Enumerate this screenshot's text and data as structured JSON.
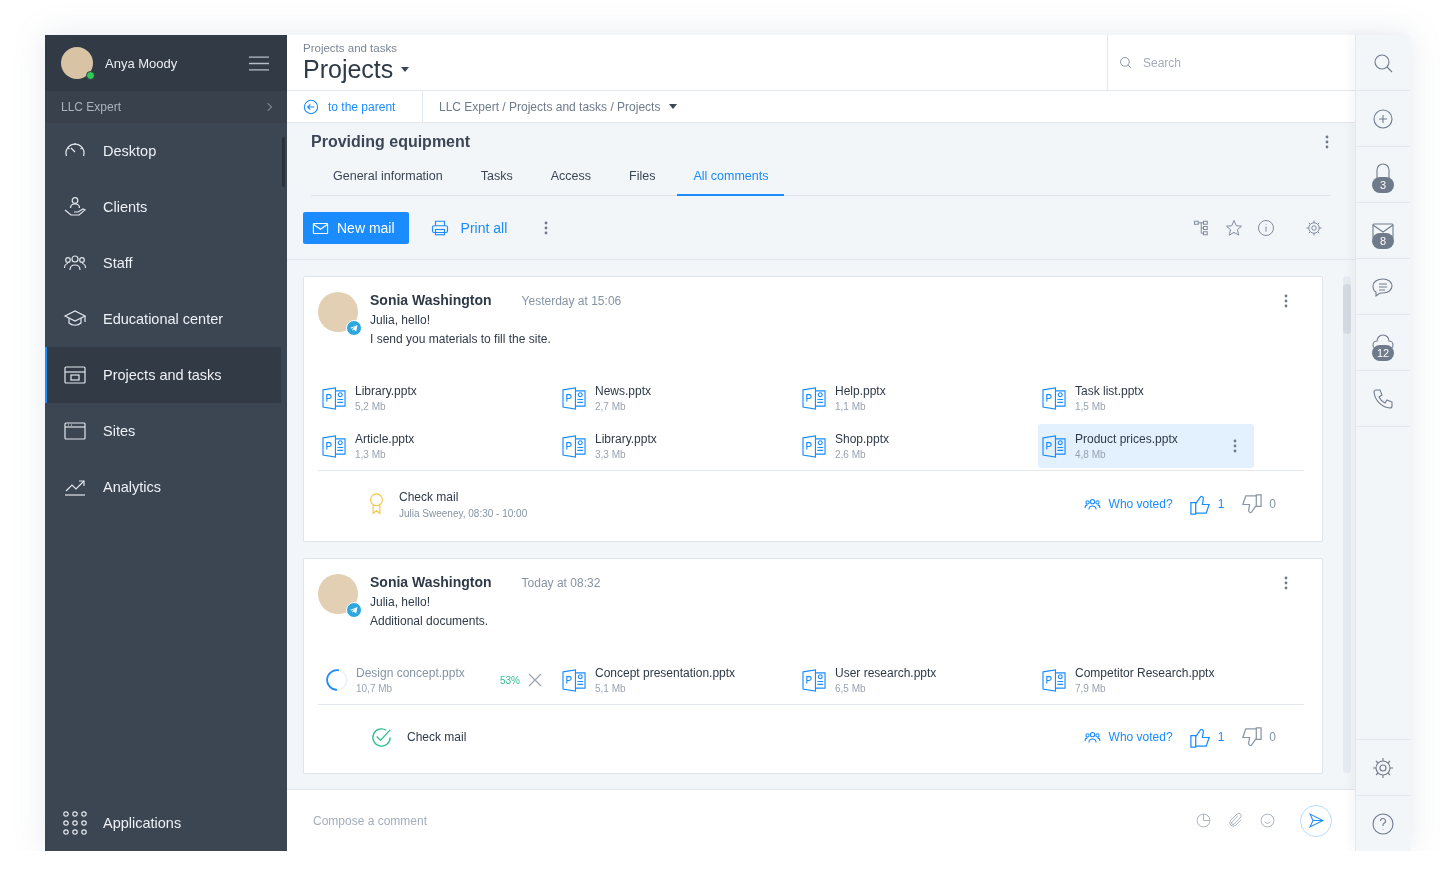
{
  "user": {
    "name": "Anya Moody",
    "online": true
  },
  "organization": "LLC Expert",
  "nav": [
    {
      "label": "Desktop",
      "selected": false
    },
    {
      "label": "Clients",
      "selected": false
    },
    {
      "label": "Staff",
      "selected": false
    },
    {
      "label": "Educational center",
      "selected": false
    },
    {
      "label": "Projects and tasks",
      "selected": true
    },
    {
      "label": "Sites",
      "selected": false
    },
    {
      "label": "Analytics",
      "selected": false
    }
  ],
  "applications": "Applications",
  "header": {
    "section": "Projects and tasks",
    "title": "Projects"
  },
  "search": {
    "placeholder": "Search"
  },
  "breadcrumb": {
    "back": "to the parent",
    "path": "LLC Expert / Projects and tasks / Projects"
  },
  "project": {
    "title": "Providing equipment",
    "tabs": [
      {
        "label": "General information",
        "selected": false
      },
      {
        "label": "Tasks",
        "selected": false
      },
      {
        "label": "Access",
        "selected": false
      },
      {
        "label": "Files",
        "selected": false
      },
      {
        "label": "All comments",
        "selected": true
      }
    ]
  },
  "toolbar": {
    "new_mail": "New mail",
    "print": "Print all"
  },
  "comments": [
    {
      "author": "Sonia Washington",
      "time": "Yesterday at 15:06",
      "lines": [
        "Julia, hello!",
        "I send you materials to fill the site."
      ],
      "files": [
        {
          "kind": "file",
          "name": "Library.pptx",
          "size": "5,2 Mb",
          "selected": false
        },
        {
          "kind": "file",
          "name": "News.pptx",
          "size": "2,7 Mb",
          "selected": false
        },
        {
          "kind": "file",
          "name": "Help.pptx",
          "size": "1,1 Mb",
          "selected": false
        },
        {
          "kind": "file",
          "name": "Task list.pptx",
          "size": "1,5 Mb",
          "selected": false
        },
        {
          "kind": "file",
          "name": "Article.pptx",
          "size": "1,3 Mb",
          "selected": false
        },
        {
          "kind": "file",
          "name": "Library.pptx",
          "size": "3,3 Mb",
          "selected": false
        },
        {
          "kind": "file",
          "name": "Shop.pptx",
          "size": "2,6 Mb",
          "selected": false
        },
        {
          "kind": "file",
          "name": "Product prices.pptx",
          "size": "4,8 Mb",
          "selected": true
        }
      ],
      "task": {
        "kind": "award",
        "title": "Check mail",
        "detail": "Julia Sweeney, 08:30 - 10:00"
      },
      "who_voted": "Who voted?",
      "likes": "1",
      "dislikes": "0"
    },
    {
      "author": "Sonia Washington",
      "time": "Today at 08:32",
      "lines": [
        "Julia, hello!",
        "Additional documents."
      ],
      "files": [
        {
          "kind": "uploading",
          "name": "Design concept.pptx",
          "size": "10,7 Mb",
          "progress": "53%",
          "level": 0.53,
          "selected": false
        },
        {
          "kind": "file",
          "name": "Concept presentation.pptx",
          "size": "5,1 Mb",
          "selected": false
        },
        {
          "kind": "file",
          "name": "User research.pptx",
          "size": "6,5 Mb",
          "selected": false
        },
        {
          "kind": "file",
          "name": "Competitor Research.pptx",
          "size": "7,9 Mb",
          "selected": false
        }
      ],
      "task": {
        "kind": "done",
        "title": "Check mail"
      },
      "who_voted": "Who voted?",
      "likes": "1",
      "dislikes": "0"
    }
  ],
  "rail_badges": [
    "3",
    "8",
    "12"
  ],
  "compose": {
    "placeholder": "Compose a comment"
  }
}
